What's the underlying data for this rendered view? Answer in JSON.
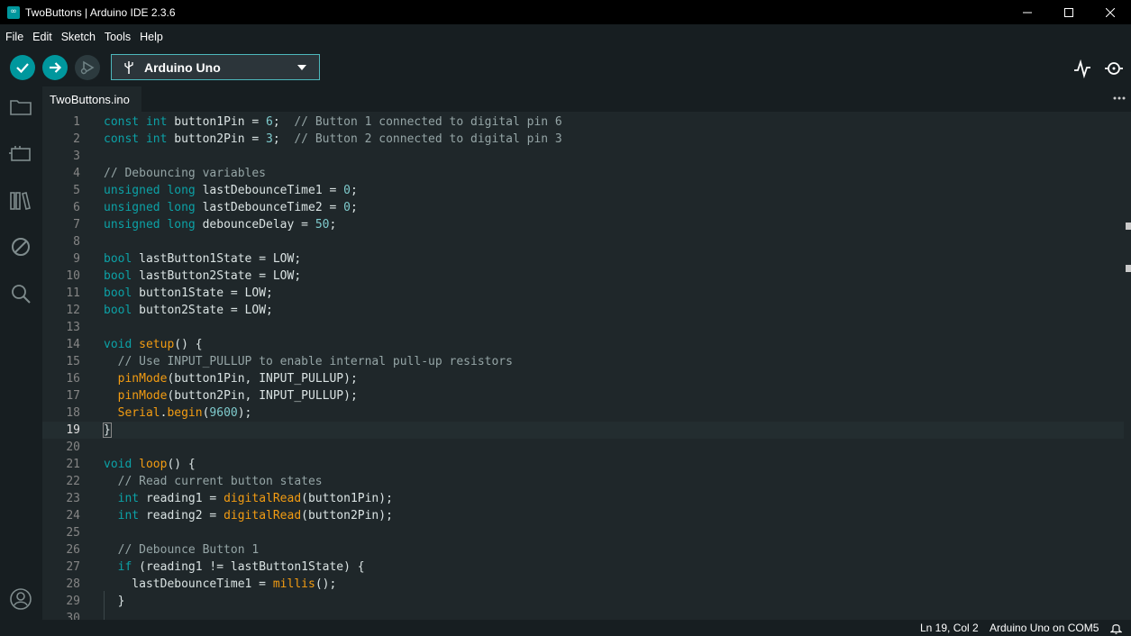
{
  "window": {
    "title": "TwoButtons | Arduino IDE 2.3.6",
    "app_icon_glyph": "∞"
  },
  "menu": {
    "items": [
      "File",
      "Edit",
      "Sketch",
      "Tools",
      "Help"
    ]
  },
  "toolbar": {
    "board_name": "Arduino Uno",
    "accent_color": "#00979d"
  },
  "tabs": [
    {
      "label": "TwoButtons.ino",
      "active": true
    }
  ],
  "editor": {
    "current_line": 19,
    "lines": [
      {
        "n": "1",
        "html_tokens": [
          [
            "kw",
            "const "
          ],
          [
            "kw",
            "int "
          ],
          [
            "",
            "button1Pin = "
          ],
          [
            "num",
            "6"
          ],
          [
            "",
            ";  "
          ],
          [
            "cm",
            "// Button 1 connected to digital pin 6"
          ]
        ]
      },
      {
        "n": "2",
        "html_tokens": [
          [
            "kw",
            "const "
          ],
          [
            "kw",
            "int "
          ],
          [
            "",
            "button2Pin = "
          ],
          [
            "num",
            "3"
          ],
          [
            "",
            ";  "
          ],
          [
            "cm",
            "// Button 2 connected to digital pin 3"
          ]
        ]
      },
      {
        "n": "3",
        "html_tokens": []
      },
      {
        "n": "4",
        "html_tokens": [
          [
            "cm",
            "// Debouncing variables"
          ]
        ]
      },
      {
        "n": "5",
        "html_tokens": [
          [
            "kw",
            "unsigned "
          ],
          [
            "kw",
            "long "
          ],
          [
            "",
            "lastDebounceTime1 = "
          ],
          [
            "num",
            "0"
          ],
          [
            "",
            ";"
          ]
        ]
      },
      {
        "n": "6",
        "html_tokens": [
          [
            "kw",
            "unsigned "
          ],
          [
            "kw",
            "long "
          ],
          [
            "",
            "lastDebounceTime2 = "
          ],
          [
            "num",
            "0"
          ],
          [
            "",
            ";"
          ]
        ]
      },
      {
        "n": "7",
        "html_tokens": [
          [
            "kw",
            "unsigned "
          ],
          [
            "kw",
            "long "
          ],
          [
            "",
            "debounceDelay = "
          ],
          [
            "num",
            "50"
          ],
          [
            "",
            ";"
          ]
        ]
      },
      {
        "n": "8",
        "html_tokens": []
      },
      {
        "n": "9",
        "html_tokens": [
          [
            "kw",
            "bool "
          ],
          [
            "",
            "lastButton1State = LOW;"
          ]
        ]
      },
      {
        "n": "10",
        "html_tokens": [
          [
            "kw",
            "bool "
          ],
          [
            "",
            "lastButton2State = LOW;"
          ]
        ]
      },
      {
        "n": "11",
        "html_tokens": [
          [
            "kw",
            "bool "
          ],
          [
            "",
            "button1State = LOW;"
          ]
        ]
      },
      {
        "n": "12",
        "html_tokens": [
          [
            "kw",
            "bool "
          ],
          [
            "",
            "button2State = LOW;"
          ]
        ]
      },
      {
        "n": "13",
        "html_tokens": []
      },
      {
        "n": "14",
        "html_tokens": [
          [
            "kw",
            "void "
          ],
          [
            "fn",
            "setup"
          ],
          [
            "",
            "() "
          ],
          [
            "",
            "{"
          ]
        ]
      },
      {
        "n": "15",
        "html_tokens": [
          [
            "",
            "  "
          ],
          [
            "cm",
            "// Use INPUT_PULLUP to enable internal pull-up resistors"
          ]
        ]
      },
      {
        "n": "16",
        "html_tokens": [
          [
            "",
            "  "
          ],
          [
            "fn",
            "pinMode"
          ],
          [
            "",
            "(button1Pin, INPUT_PULLUP);"
          ]
        ]
      },
      {
        "n": "17",
        "html_tokens": [
          [
            "",
            "  "
          ],
          [
            "fn",
            "pinMode"
          ],
          [
            "",
            "(button2Pin, INPUT_PULLUP);"
          ]
        ]
      },
      {
        "n": "18",
        "html_tokens": [
          [
            "",
            "  "
          ],
          [
            "fn",
            "Serial"
          ],
          [
            "",
            "."
          ],
          [
            "fn",
            "begin"
          ],
          [
            "",
            "("
          ],
          [
            "num",
            "9600"
          ],
          [
            "",
            ");"
          ]
        ]
      },
      {
        "n": "19",
        "html_tokens": [
          [
            "",
            "}"
          ]
        ]
      },
      {
        "n": "20",
        "html_tokens": []
      },
      {
        "n": "21",
        "html_tokens": [
          [
            "kw",
            "void "
          ],
          [
            "fn",
            "loop"
          ],
          [
            "",
            "() {"
          ]
        ]
      },
      {
        "n": "22",
        "html_tokens": [
          [
            "",
            "  "
          ],
          [
            "cm",
            "// Read current button states"
          ]
        ]
      },
      {
        "n": "23",
        "html_tokens": [
          [
            "",
            "  "
          ],
          [
            "kw",
            "int "
          ],
          [
            "",
            "reading1 = "
          ],
          [
            "fn",
            "digitalRead"
          ],
          [
            "",
            "(button1Pin);"
          ]
        ]
      },
      {
        "n": "24",
        "html_tokens": [
          [
            "",
            "  "
          ],
          [
            "kw",
            "int "
          ],
          [
            "",
            "reading2 = "
          ],
          [
            "fn",
            "digitalRead"
          ],
          [
            "",
            "(button2Pin);"
          ]
        ]
      },
      {
        "n": "25",
        "html_tokens": []
      },
      {
        "n": "26",
        "html_tokens": [
          [
            "",
            "  "
          ],
          [
            "cm",
            "// Debounce Button 1"
          ]
        ]
      },
      {
        "n": "27",
        "html_tokens": [
          [
            "",
            "  "
          ],
          [
            "kw",
            "if "
          ],
          [
            "",
            "(reading1 != lastButton1State) {"
          ]
        ]
      },
      {
        "n": "28",
        "html_tokens": [
          [
            "",
            "    lastDebounceTime1 = "
          ],
          [
            "fn",
            "millis"
          ],
          [
            "",
            "();"
          ]
        ]
      },
      {
        "n": "29",
        "html_tokens": [
          [
            "",
            "  }"
          ]
        ]
      },
      {
        "n": "30",
        "html_tokens": []
      }
    ]
  },
  "status": {
    "position": "Ln 19, Col 2",
    "board_port": "Arduino Uno on COM5"
  }
}
